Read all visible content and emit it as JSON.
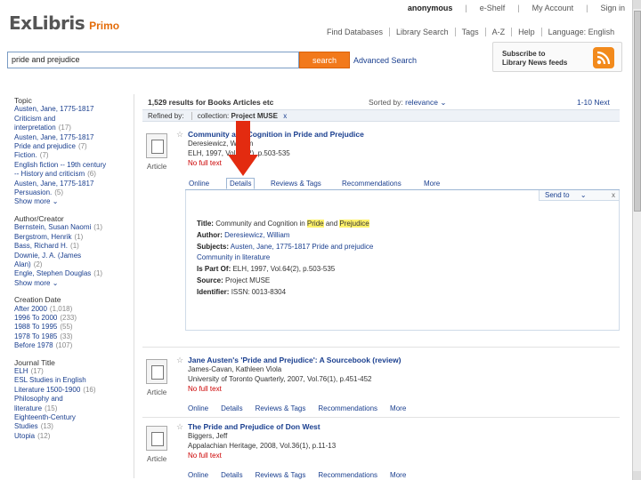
{
  "topnav": {
    "user": "anonymous",
    "eshelf": "e-Shelf",
    "my_account": "My Account",
    "sign_in": "Sign in"
  },
  "logo": {
    "brand": "ExLibris",
    "product": "Primo"
  },
  "mainnav": [
    "Find Databases",
    "Library Search",
    "Tags",
    "A-Z",
    "Help",
    "Language: English"
  ],
  "search": {
    "query": "pride and prejudice",
    "button": "search",
    "advanced": "Advanced Search"
  },
  "rss": {
    "line1": "Subscribe to",
    "line2": "Library News feeds"
  },
  "facets": [
    {
      "title": "Topic",
      "items": [
        {
          "label": "Austen, Jane, 1775-1817",
          "count": ""
        },
        {
          "label": "Criticism and",
          "count": ""
        },
        {
          "label": "interpretation",
          "count": "(17)"
        },
        {
          "label": "Austen, Jane, 1775-1817",
          "count": ""
        },
        {
          "label": "Pride and prejudice",
          "count": "(7)"
        },
        {
          "label": "Fiction.",
          "count": "(7)"
        },
        {
          "label": "English fiction -- 19th century",
          "count": ""
        },
        {
          "label": "-- History and criticism",
          "count": "(6)"
        },
        {
          "label": "Austen, Jane, 1775-1817",
          "count": ""
        },
        {
          "label": "Persuasion.",
          "count": "(5)"
        }
      ],
      "more": "Show more"
    },
    {
      "title": "Author/Creator",
      "items": [
        {
          "label": "Bernstein, Susan Naomi",
          "count": "(1)"
        },
        {
          "label": "Bergstrom, Henrik",
          "count": "(1)"
        },
        {
          "label": "Bass, Richard H.",
          "count": "(1)"
        },
        {
          "label": "Downie, J. A. (James",
          "count": ""
        },
        {
          "label": "Alan)",
          "count": "(2)"
        },
        {
          "label": "Engle, Stephen Douglas",
          "count": "(1)"
        }
      ],
      "more": "Show more"
    },
    {
      "title": "Creation Date",
      "items": [
        {
          "label": "After 2000",
          "count": "(1,018)"
        },
        {
          "label": "1996 To 2000",
          "count": "(233)"
        },
        {
          "label": "1988 To 1995",
          "count": "(55)"
        },
        {
          "label": "1978 To 1985",
          "count": "(33)"
        },
        {
          "label": "Before 1978",
          "count": "(107)"
        }
      ],
      "more": ""
    },
    {
      "title": "Journal Title",
      "items": [
        {
          "label": "ELH",
          "count": "(17)"
        },
        {
          "label": "ESL Studies in English",
          "count": ""
        },
        {
          "label": "Literature 1500-1900",
          "count": "(16)"
        },
        {
          "label": "Philosophy and",
          "count": ""
        },
        {
          "label": "literature",
          "count": "(15)"
        },
        {
          "label": "Eighteenth-Century",
          "count": ""
        },
        {
          "label": "Studies",
          "count": "(13)"
        },
        {
          "label": "Utopia",
          "count": "(12)"
        }
      ],
      "more": ""
    }
  ],
  "results_header": {
    "count_text": "1,529 results for Books Articles etc",
    "sort_label": "Sorted by:",
    "sort_value": "relevance",
    "paging": "1-10 Next"
  },
  "refined": {
    "label": "Refined by:",
    "field": "collection:",
    "value": "Project MUSE",
    "remove": "x"
  },
  "results": [
    {
      "title": "Community and Cognition in Pride and Prejudice",
      "author": "Deresiewicz, William",
      "source": "ELH, 1997, Vol.64(2), p.503-535",
      "availability": "No full text",
      "format": "Article",
      "tabs": [
        "Online",
        "Details",
        "Reviews & Tags",
        "Recommendations",
        "More"
      ]
    },
    {
      "title": "Jane Austen's 'Pride and Prejudice': A Sourcebook (review)",
      "author": "James-Cavan, Kathleen Viola",
      "source": "University of Toronto Quarterly, 2007, Vol.76(1), p.451-452",
      "availability": "No full text",
      "format": "Article",
      "tabs": [
        "Online",
        "Details",
        "Reviews & Tags",
        "Recommendations",
        "More"
      ]
    },
    {
      "title": "The Pride and Prejudice of Don West",
      "author": "Biggers, Jeff",
      "source": "Appalachian Heritage, 2008, Vol.36(1), p.11-13",
      "availability": "No full text",
      "format": "Article",
      "tabs": [
        "Online",
        "Details",
        "Reviews & Tags",
        "Recommendations",
        "More"
      ]
    }
  ],
  "details": {
    "send_to": "Send to",
    "close": "x",
    "title_label": "Title:",
    "title_pre": "Community and Cognition in ",
    "title_hl1": "Pride",
    "title_mid": " and ",
    "title_hl2": "Prejudice",
    "author_label": "Author:",
    "author": "Deresiewicz, William",
    "subjects_label": "Subjects:",
    "subjects_1": "Austen, Jane, 1775-1817 Pride and prejudice",
    "subjects_2": "Community in literature",
    "ispartof_label": "Is Part Of:",
    "ispartof": "ELH, 1997, Vol.64(2), p.503-535",
    "source_label": "Source:",
    "source": "Project MUSE",
    "identifier_label": "Identifier:",
    "identifier": "ISSN: 0013-8304"
  },
  "colors": {
    "accent": "#f2791b",
    "link": "#1a3f8f",
    "alert": "#cc0000",
    "highlight": "#fff26b",
    "arrow": "#e32b10"
  }
}
